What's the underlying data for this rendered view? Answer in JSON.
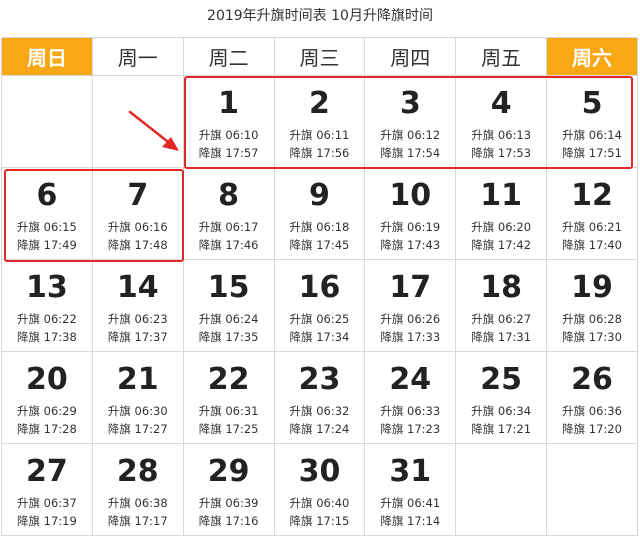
{
  "title": "2019年升旗时间表 10月升降旗时间",
  "weekdays": [
    "周日",
    "周一",
    "周二",
    "周三",
    "周四",
    "周五",
    "周六"
  ],
  "weeks": [
    [
      null,
      null,
      {
        "day": "1",
        "up": "升旗 06:10",
        "down": "降旗 17:57"
      },
      {
        "day": "2",
        "up": "升旗 06:11",
        "down": "降旗 17:56"
      },
      {
        "day": "3",
        "up": "升旗 06:12",
        "down": "降旗 17:54"
      },
      {
        "day": "4",
        "up": "升旗 06:13",
        "down": "降旗 17:53"
      },
      {
        "day": "5",
        "up": "升旗 06:14",
        "down": "降旗 17:51"
      }
    ],
    [
      {
        "day": "6",
        "up": "升旗 06:15",
        "down": "降旗 17:49"
      },
      {
        "day": "7",
        "up": "升旗 06:16",
        "down": "降旗 17:48"
      },
      {
        "day": "8",
        "up": "升旗 06:17",
        "down": "降旗 17:46"
      },
      {
        "day": "9",
        "up": "升旗 06:18",
        "down": "降旗 17:45"
      },
      {
        "day": "10",
        "up": "升旗 06:19",
        "down": "降旗 17:43"
      },
      {
        "day": "11",
        "up": "升旗 06:20",
        "down": "降旗 17:42"
      },
      {
        "day": "12",
        "up": "升旗 06:21",
        "down": "降旗 17:40"
      }
    ],
    [
      {
        "day": "13",
        "up": "升旗 06:22",
        "down": "降旗 17:38"
      },
      {
        "day": "14",
        "up": "升旗 06:23",
        "down": "降旗 17:37"
      },
      {
        "day": "15",
        "up": "升旗 06:24",
        "down": "降旗 17:35"
      },
      {
        "day": "16",
        "up": "升旗 06:25",
        "down": "降旗 17:34"
      },
      {
        "day": "17",
        "up": "升旗 06:26",
        "down": "降旗 17:33"
      },
      {
        "day": "18",
        "up": "升旗 06:27",
        "down": "降旗 17:31"
      },
      {
        "day": "19",
        "up": "升旗 06:28",
        "down": "降旗 17:30"
      }
    ],
    [
      {
        "day": "20",
        "up": "升旗 06:29",
        "down": "降旗 17:28"
      },
      {
        "day": "21",
        "up": "升旗 06:30",
        "down": "降旗 17:27"
      },
      {
        "day": "22",
        "up": "升旗 06:31",
        "down": "降旗 17:25"
      },
      {
        "day": "23",
        "up": "升旗 06:32",
        "down": "降旗 17:24"
      },
      {
        "day": "24",
        "up": "升旗 06:33",
        "down": "降旗 17:23"
      },
      {
        "day": "25",
        "up": "升旗 06:34",
        "down": "降旗 17:21"
      },
      {
        "day": "26",
        "up": "升旗 06:36",
        "down": "降旗 17:20"
      }
    ],
    [
      {
        "day": "27",
        "up": "升旗 06:37",
        "down": "降旗 17:19"
      },
      {
        "day": "28",
        "up": "升旗 06:38",
        "down": "降旗 17:17"
      },
      {
        "day": "29",
        "up": "升旗 06:39",
        "down": "降旗 17:16"
      },
      {
        "day": "30",
        "up": "升旗 06:40",
        "down": "降旗 17:15"
      },
      {
        "day": "31",
        "up": "升旗 06:41",
        "down": "降旗 17:14"
      },
      null,
      null
    ]
  ],
  "colors": {
    "weekend_header": "#f8a815",
    "highlight": "#e32626"
  },
  "icons": {
    "pointer": "arrow-icon"
  }
}
